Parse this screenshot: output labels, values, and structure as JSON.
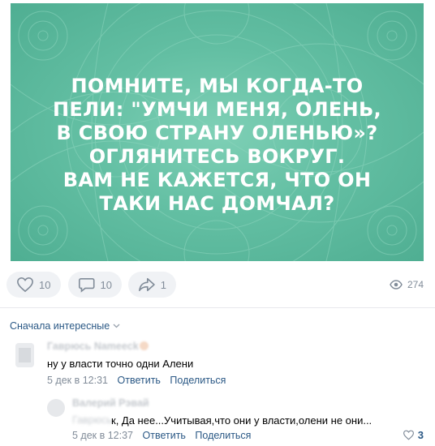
{
  "post": {
    "quote_lines": [
      "ПОМНИТЕ, МЫ КОГДА-ТО",
      "ПЕЛИ: \"УМЧИ МЕНЯ, ОЛЕНЬ,",
      "В СВОЮ СТРАНУ ОЛЕНЬЮ»?",
      "ОГЛЯНИТЕСЬ ВОКРУГ.",
      "ВАМ НЕ КАЖЕТСЯ, ЧТО ОН",
      "ТАКИ НАС ДОМЧАЛ?"
    ],
    "image_colors": {
      "base": "#5fbb9f",
      "pattern": "#8fd6bf"
    }
  },
  "actions": {
    "likes": "10",
    "comments": "10",
    "shares": "1",
    "views": "274"
  },
  "comments": {
    "sort_label": "Сначала интересные",
    "items": [
      {
        "author": "Гаврюсь Nameeck",
        "text": "ну у власти точно одни Алени",
        "date": "5 дек в 12:31",
        "reply_label": "Ответить",
        "share_label": "Поделиться"
      },
      {
        "author": "Валерий Рэвай",
        "reply_to": "Гаврюсь",
        "text": "к, Да нее...Учитывая,что они у власти,олени не они...",
        "date": "5 дек в 12:37",
        "reply_label": "Ответить",
        "share_label": "Поделиться",
        "likes": "3"
      }
    ]
  },
  "colors": {
    "link": "#2a5885",
    "muted": "#818c99",
    "pill_bg": "#f0f2f5"
  }
}
